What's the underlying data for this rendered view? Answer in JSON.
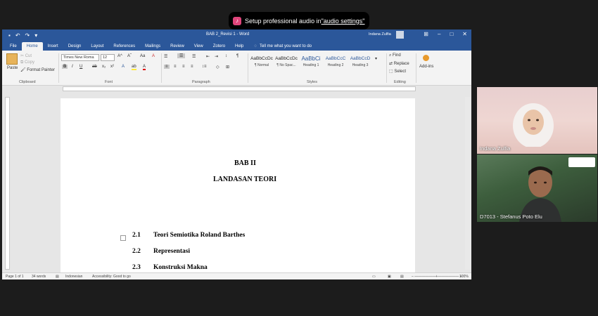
{
  "notification": {
    "text": "Setup professional audio in ",
    "link": "\"audio settings\""
  },
  "word": {
    "doc_title": "BAB 2_Revisi 1  -  Word",
    "user_name": "Indana Zulfia",
    "menu_tabs": [
      "File",
      "Home",
      "Insert",
      "Design",
      "Layout",
      "References",
      "Mailings",
      "Review",
      "View",
      "Zotero",
      "Help"
    ],
    "tell_me": "Tell me what you want to do",
    "clipboard": {
      "paste": "Paste",
      "cut": "Cut",
      "copy": "Copy",
      "format_painter": "Format Painter",
      "label": "Clipboard"
    },
    "font": {
      "name": "Times New Roma",
      "size": "12",
      "label": "Font"
    },
    "paragraph_label": "Paragraph",
    "styles": [
      {
        "preview": "AaBbCcDc",
        "name": "¶ Normal"
      },
      {
        "preview": "AaBbCcDc",
        "name": "¶ No Spac..."
      },
      {
        "preview": "AaBbCi",
        "name": "Heading 1"
      },
      {
        "preview": "AaBbCcC",
        "name": "Heading 2"
      },
      {
        "preview": "AaBbCcD",
        "name": "Heading 3"
      }
    ],
    "styles_label": "Styles",
    "editing": {
      "find": "Find",
      "replace": "Replace",
      "select": "Select",
      "label": "Editing"
    },
    "addins": {
      "label": "Add-ins"
    },
    "document": {
      "heading1": "BAB II",
      "heading2": "LANDASAN TEORI",
      "sections": [
        {
          "num": "2.1",
          "title": "Teori Semiotika Roland Barthes"
        },
        {
          "num": "2.2",
          "title": "Representasi"
        },
        {
          "num": "2.3",
          "title": "Konstruksi Makna"
        }
      ]
    },
    "status": {
      "page": "Page 1 of 1",
      "words": "34 words",
      "language": "Indonesian",
      "accessibility": "Accessibility: Good to go",
      "zoom": "100%"
    }
  },
  "participants": [
    {
      "name": "Indana Zulfia"
    },
    {
      "name": "D7013 - Stefanus Poto Elu"
    }
  ]
}
